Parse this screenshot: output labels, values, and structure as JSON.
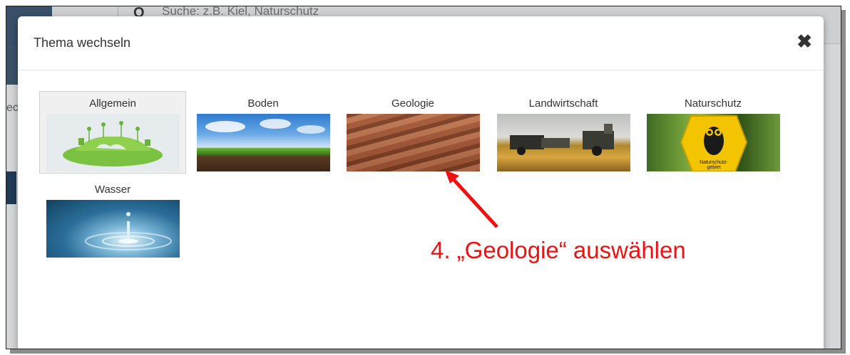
{
  "background_app": {
    "search_placeholder": "Suche: z.B. Kiel, Naturschutz",
    "side_text": "ec"
  },
  "modal": {
    "title": "Thema wechseln",
    "close_symbol": "✖",
    "themes": [
      {
        "label": "Allgemein",
        "selected": true,
        "image": "green-globe-icon"
      },
      {
        "label": "Boden",
        "selected": false,
        "image": "soil-grass-photo"
      },
      {
        "label": "Geologie",
        "selected": false,
        "image": "rock-strata-photo"
      },
      {
        "label": "Landwirtschaft",
        "selected": false,
        "image": "combine-harvester-photo"
      },
      {
        "label": "Naturschutz",
        "selected": false,
        "image": "owl-nature-reserve-sign-photo"
      },
      {
        "label": "Wasser",
        "selected": false,
        "image": "water-drop-photo"
      }
    ]
  },
  "annotation": {
    "text": "4. „Geologie“ auswählen",
    "color": "#ee1111"
  },
  "sign_text": "Naturschutz-\ngebiet"
}
